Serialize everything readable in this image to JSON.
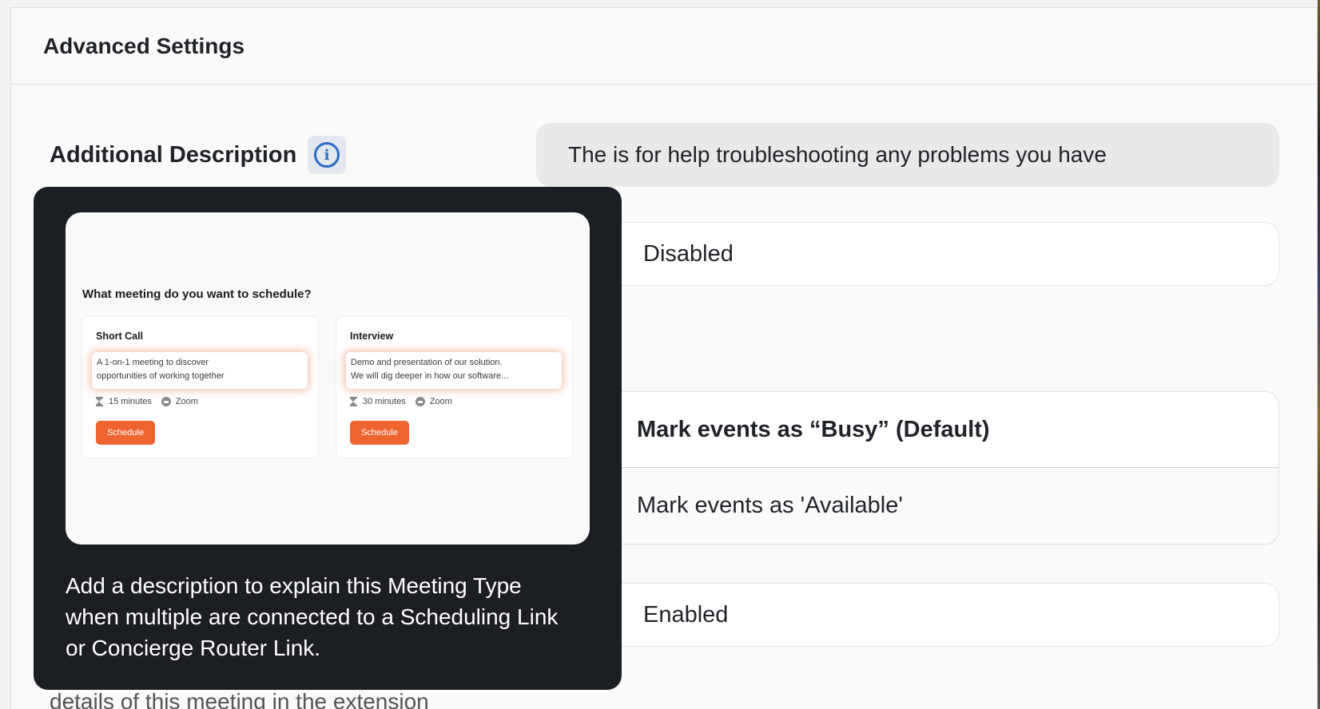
{
  "section": {
    "title": "Advanced Settings"
  },
  "description_row": {
    "label": "Additional Description",
    "info_icon": "info-icon",
    "value": "The is for help troubleshooting any problems you have"
  },
  "select_disabled": {
    "value": "Disabled"
  },
  "busy_options": {
    "items": [
      {
        "label": "Mark events as “Busy” (Default)",
        "selected": true
      },
      {
        "label": "Mark events as 'Available'",
        "selected": false
      }
    ]
  },
  "select_enabled": {
    "value": "Enabled"
  },
  "bottom_text": "details of this meeting in the extension",
  "tooltip": {
    "preview": {
      "question": "What meeting do you want to schedule?",
      "cards": [
        {
          "title": "Short Call",
          "desc_line1": "A 1-on-1 meeting to discover",
          "desc_line2": "opportunities of working together",
          "duration": "15 minutes",
          "location": "Zoom",
          "button": "Schedule"
        },
        {
          "title": "Interview",
          "desc_line1": "Demo and presentation of our solution.",
          "desc_line2": "We will dig deeper in how our software...",
          "duration": "30 minutes",
          "location": "Zoom",
          "button": "Schedule"
        }
      ]
    },
    "text": "Add a description to explain this Meeting Type when multiple are connected to a Scheduling Link or Concierge Router Link."
  },
  "colors": {
    "accent_blue": "#2b6cc4",
    "schedule_orange": "#ee6530",
    "tooltip_bg": "#1b1f24"
  }
}
